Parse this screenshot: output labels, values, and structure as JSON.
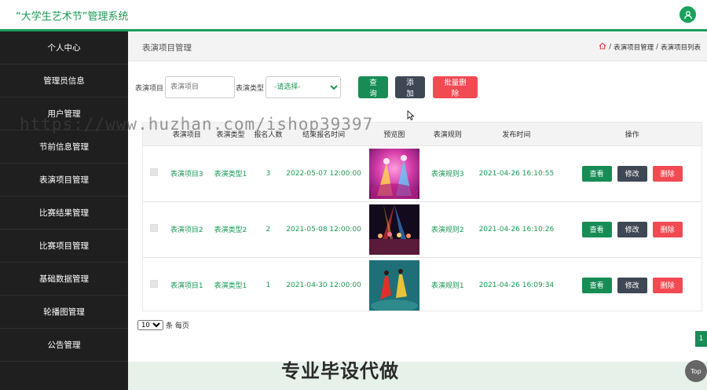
{
  "app": {
    "title": "“大学生艺术节”管理系统"
  },
  "sidebar": {
    "items": [
      {
        "label": "个人中心"
      },
      {
        "label": "管理员信息"
      },
      {
        "label": "用户管理"
      },
      {
        "label": "节前信息管理"
      },
      {
        "label": "表演项目管理"
      },
      {
        "label": "比赛结果管理"
      },
      {
        "label": "比赛项目管理"
      },
      {
        "label": "基础数据管理"
      },
      {
        "label": "轮播图管理"
      },
      {
        "label": "公告管理"
      }
    ]
  },
  "header": {
    "page_title": "表演项目管理",
    "breadcrumb": {
      "sep": "/",
      "level1": "表演项目管理",
      "level2": "表演项目列表"
    }
  },
  "search": {
    "name_label": "表演项目",
    "name_placeholder": "表演项目",
    "type_label": "表演类型",
    "type_selected": "-请选择-",
    "query_button": "查询",
    "add_button": "添加",
    "batch_delete_button": "批量删除"
  },
  "table": {
    "headers": [
      "表演项目",
      "表演类型",
      "报名人数",
      "结束报名时间",
      "预览图",
      "表演规则",
      "发布时间",
      "操作"
    ],
    "rows": [
      {
        "name": "表演项目3",
        "type": "表演类型1",
        "count": "3",
        "end_time": "2022-05-07 12:00:00",
        "rule": "表演规则3",
        "publish_time": "2021-04-26 16:10:55"
      },
      {
        "name": "表演项目2",
        "type": "表演类型2",
        "count": "2",
        "end_time": "2021-05-08 12:00:00",
        "rule": "表演规则2",
        "publish_time": "2021-04-26 16:10:26"
      },
      {
        "name": "表演项目1",
        "type": "表演类型1",
        "count": "1",
        "end_time": "2021-04-30 12:00:00",
        "rule": "表演规则1",
        "publish_time": "2021-04-26 16:09:34"
      }
    ],
    "actions": {
      "view": "查看",
      "edit": "修改",
      "delete": "删除"
    }
  },
  "pagination": {
    "page_size": "10",
    "per_page_text": "条 每页",
    "current_page": "1"
  },
  "overlay": {
    "watermark": "https://www.huzhan.com/ishop39397",
    "promo": "专业毕设代做",
    "top_button": "Top"
  },
  "colors": {
    "accent": "#1aa05a",
    "sidebar": "#1f1f1f",
    "danger": "#f24a53",
    "dark_button": "#3f4755"
  }
}
